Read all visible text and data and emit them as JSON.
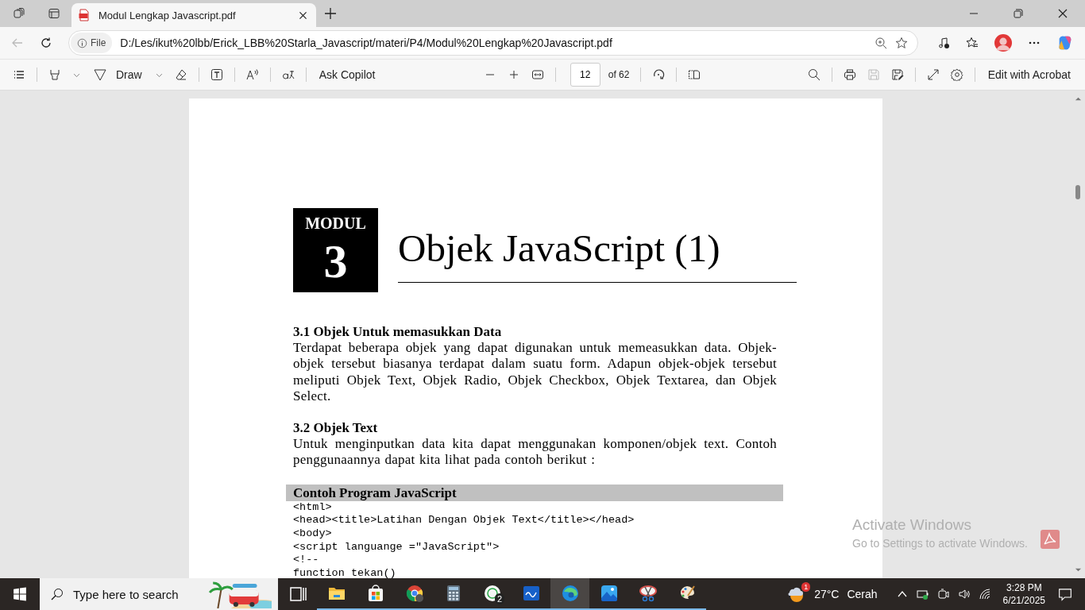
{
  "browser": {
    "tab": {
      "title": "Modul Lengkap Javascript.pdf",
      "selected": true
    },
    "address": {
      "scheme": "File",
      "url": "D:/Les/ikut%20lbb/Erick_LBB%20Starla_Javascript/materi/P4/Modul%20Lengkap%20Javascript.pdf"
    }
  },
  "pdf_toolbar": {
    "draw_label": "Draw",
    "ask_label": "Ask Copilot",
    "page_number": "12",
    "page_total": "of 62",
    "edit_label": "Edit with Acrobat"
  },
  "document": {
    "module_label": "MODUL",
    "module_number": "3",
    "title": "Objek JavaScript (1)",
    "sections": [
      {
        "heading": "3.1 Objek Untuk memasukkan Data",
        "body": "Terdapat beberapa objek yang dapat digunakan untuk memeasukkan data. Objek-objek tersebut biasanya terdapat dalam suatu form. Adapun objek-objek tersebut meliputi Objek Text, Objek Radio, Objek Checkbox, Objek Textarea, dan Objek Select."
      },
      {
        "heading": "3.2 Objek Text",
        "body": "Untuk menginputkan data kita dapat menggunakan komponen/objek text. Contoh penggunaannya dapat kita lihat pada contoh berikut :"
      }
    ],
    "code_box": {
      "title": "Contoh Program JavaScript",
      "lines": [
        "<html>",
        "<head><title>Latihan Dengan Objek Text</title></head>",
        "<body>",
        "<script languange =\"JavaScript\">",
        "<!--",
        "function tekan()"
      ]
    }
  },
  "activation": {
    "title": "Activate Windows",
    "message": "Go to Settings to activate Windows."
  },
  "taskbar": {
    "search_placeholder": "Type here to search",
    "apps": [
      {
        "kind": "taskview",
        "running": false,
        "selected": false
      },
      {
        "kind": "explorer",
        "running": true,
        "selected": false
      },
      {
        "kind": "store",
        "running": true,
        "selected": false
      },
      {
        "kind": "chrome",
        "running": true,
        "selected": false
      },
      {
        "kind": "calculator",
        "running": true,
        "selected": false
      },
      {
        "kind": "whatsapp",
        "running": true,
        "selected": false,
        "badge": "2"
      },
      {
        "kind": "whiteboard",
        "running": true,
        "selected": false
      },
      {
        "kind": "edge",
        "running": true,
        "selected": true
      },
      {
        "kind": "photos",
        "running": true,
        "selected": false
      },
      {
        "kind": "snip",
        "running": true,
        "selected": false
      },
      {
        "kind": "paint",
        "running": true,
        "selected": false
      }
    ],
    "weather": {
      "badge": "1",
      "temperature": "27°C",
      "condition": "Cerah"
    },
    "time": "3:28 PM",
    "date": "6/21/2025"
  }
}
